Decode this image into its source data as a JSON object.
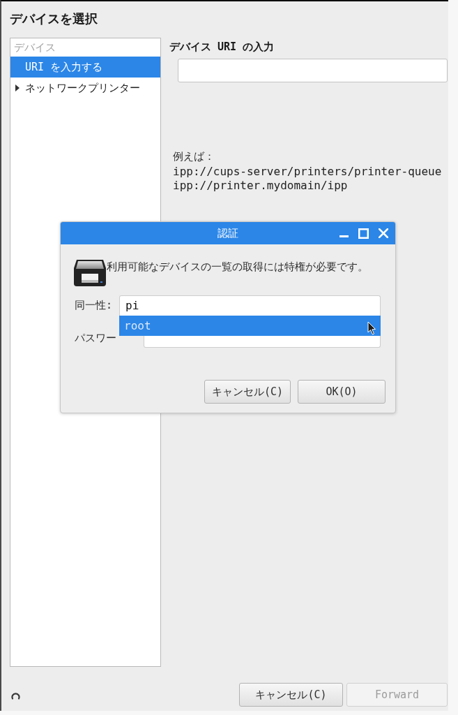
{
  "window": {
    "title": "デバイスを選択"
  },
  "device_list": {
    "header": "デバイス",
    "items": [
      {
        "kind": "entry",
        "label": "URI を入力する",
        "selected": true
      },
      {
        "kind": "group",
        "label": "ネットワークプリンター",
        "selected": false,
        "expanded": false
      }
    ]
  },
  "uri_entry": {
    "heading": "デバイス URI の入力"
  },
  "examples": {
    "label": "例えば：",
    "lines": [
      "ipp://cups-server/printers/printer-queue",
      "ipp://printer.mydomain/ipp"
    ]
  },
  "auth_dialog": {
    "title": "認証",
    "message": "利用可能なデバイスの一覧の取得には特権が必要です。",
    "identity": {
      "label": "同一性:",
      "value": "pi"
    },
    "suggestions": [
      {
        "label": "root",
        "selected": true
      }
    ],
    "password": {
      "label": "パスワー"
    },
    "buttons": [
      {
        "label": "キャンセル(C)"
      },
      {
        "label": "OK(O)"
      }
    ]
  },
  "footer": {
    "busy": true,
    "buttons": [
      {
        "label": "キャンセル(C)",
        "disabled": false
      },
      {
        "label": "Forward",
        "disabled": true
      }
    ]
  }
}
